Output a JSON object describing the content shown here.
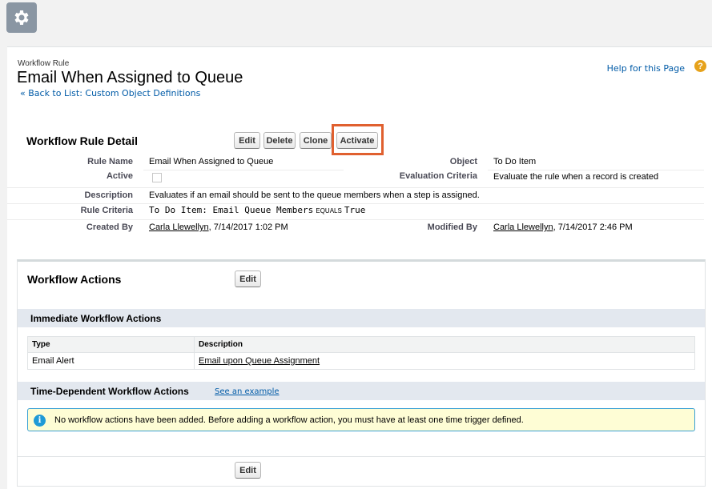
{
  "header": {
    "setup_icon": "gear-icon"
  },
  "page": {
    "type_label": "Workflow Rule",
    "title": "Email When Assigned to Queue",
    "back_link_prefix": "«",
    "back_link": "Back to List: Custom Object Definitions",
    "help_link": "Help for this Page",
    "help_icon": "?"
  },
  "detail": {
    "section_title": "Workflow Rule Detail",
    "buttons": {
      "edit": "Edit",
      "delete": "Delete",
      "clone": "Clone",
      "activate": "Activate"
    },
    "fields": {
      "rule_name_label": "Rule Name",
      "rule_name": "Email When Assigned to Queue",
      "object_label": "Object",
      "object": "To Do Item",
      "active_label": "Active",
      "active": false,
      "evaluation_label": "Evaluation Criteria",
      "evaluation": "Evaluate the rule when a record is created",
      "description_label": "Description",
      "description": "Evaluates if an email should be sent to the queue members when a step is assigned.",
      "criteria_label": "Rule Criteria",
      "criteria_field": "To Do Item: Email Queue Members",
      "criteria_operator": "EQUALS",
      "criteria_value": "True",
      "created_by_label": "Created By",
      "created_by_user": "Carla Llewellyn",
      "created_by_date": ", 7/14/2017 1:02 PM",
      "modified_by_label": "Modified By",
      "modified_by_user": "Carla Llewellyn",
      "modified_by_date": ", 7/14/2017 2:46 PM"
    }
  },
  "actions": {
    "section_title": "Workflow Actions",
    "edit_label": "Edit",
    "immediate_title": "Immediate Workflow Actions",
    "table": {
      "columns": [
        "Type",
        "Description"
      ],
      "rows": [
        {
          "type": "Email Alert",
          "description": "Email upon Queue Assignment"
        }
      ]
    },
    "time_dependent_title": "Time-Dependent Workflow Actions",
    "example_link": "See an example",
    "info_icon": "i",
    "info_message": "No workflow actions have been added. Before adding a workflow action, you must have at least one time trigger defined.",
    "bottom_edit_label": "Edit"
  },
  "colors": {
    "link": "#015ba7",
    "highlight": "#e0602f",
    "info_border": "#39a0d5",
    "info_bg": "#fefdd5",
    "help_icon": "#e6a21b"
  }
}
